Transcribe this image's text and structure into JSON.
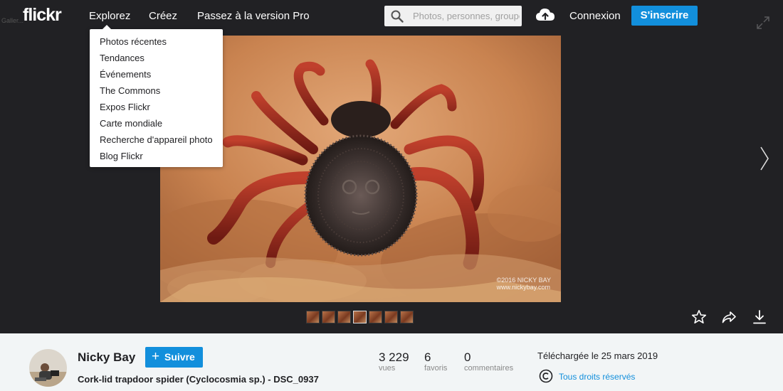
{
  "header": {
    "logo": "flickr",
    "nav": {
      "explore": "Explorez",
      "create": "Créez",
      "pro": "Passez à la version Pro"
    },
    "search": {
      "placeholder": "Photos, personnes, groupes",
      "value": ""
    },
    "login": "Connexion",
    "signup": "S'inscrire",
    "ghost_text": "Galler..."
  },
  "explore_menu": {
    "items": [
      "Photos récentes",
      "Tendances",
      "Événements",
      "The Commons",
      "Expos Flickr",
      "Carte mondiale",
      "Recherche d'appareil photo",
      "Blog Flickr"
    ]
  },
  "photo": {
    "watermark_line1": "©2016 NICKY BAY",
    "watermark_line2": "www.nickybay.com"
  },
  "filmstrip": {
    "count": 7,
    "active_index": 3
  },
  "info": {
    "author": "Nicky Bay",
    "follow_label": "Suivre",
    "title": "Cork-lid trapdoor spider (Cyclocosmia sp.) - DSC_0937",
    "stats": [
      {
        "value": "3 229",
        "label": "vues"
      },
      {
        "value": "6",
        "label": "favoris"
      },
      {
        "value": "0",
        "label": "commentaires"
      }
    ],
    "uploaded": "Téléchargée le 25 mars 2019",
    "rights": "Tous droits réservés"
  },
  "colors": {
    "accent": "#128fdc",
    "background": "#212124",
    "infobar": "#f2f5f6"
  },
  "icons": [
    "search-icon",
    "upload-cloud-icon",
    "expand-icon",
    "chevron-right-icon",
    "star-icon",
    "share-icon",
    "download-icon",
    "copyright-icon",
    "plus-icon"
  ]
}
